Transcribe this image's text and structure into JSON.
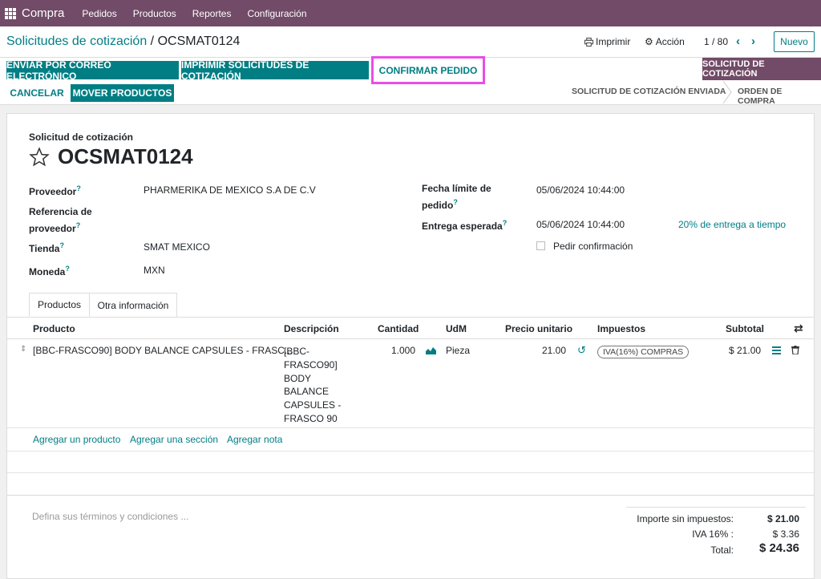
{
  "topbar": {
    "brand": "Compra",
    "menu": [
      "Pedidos",
      "Productos",
      "Reportes",
      "Configuración"
    ]
  },
  "breadcrumb": {
    "parent": "Solicitudes de cotización",
    "separator": "/",
    "current": "OCSMAT0124"
  },
  "cp_actions": {
    "print": "Imprimir",
    "action": "Acción",
    "pager": "1 / 80",
    "new": "Nuevo"
  },
  "buttons": {
    "send_email": "ENVIAR POR CORREO ELECTRÓNICO",
    "print_rfq": "IMPRIMIR SOLICITUDES DE COTIZACIÓN",
    "confirm": "CONFIRMAR PEDIDO",
    "cancel": "CANCELAR",
    "move": "MOVER PRODUCTOS"
  },
  "statusbar": {
    "active": "SOLICITUD DE COTIZACIÓN",
    "sent": "SOLICITUD DE COTIZACIÓN ENVIADA",
    "order": "ORDEN DE COMPRA"
  },
  "form": {
    "subtitle": "Solicitud de cotización",
    "name": "OCSMAT0124",
    "proveedor_label": "Proveedor",
    "proveedor": "PHARMERIKA DE MEXICO S.A DE C.V",
    "ref_label_1": "Referencia de",
    "ref_label_2": "proveedor",
    "tienda_label": "Tienda",
    "tienda": "SMAT MEXICO",
    "moneda_label": "Moneda",
    "moneda": "MXN",
    "fecha_label_1": "Fecha límite de",
    "fecha_label_2": "pedido",
    "fecha": "05/06/2024 10:44:00",
    "entrega_label": "Entrega esperada",
    "entrega": "05/06/2024 10:44:00",
    "entrega_pct": "20% de entrega a tiempo",
    "pedir_conf": "Pedir confirmación",
    "q": "?"
  },
  "tabs": {
    "productos": "Productos",
    "otra": "Otra información"
  },
  "table": {
    "headers": {
      "producto": "Producto",
      "descripcion": "Descripción",
      "cantidad": "Cantidad",
      "udm": "UdM",
      "precio": "Precio unitario",
      "impuestos": "Impuestos",
      "subtotal": "Subtotal"
    },
    "row": {
      "producto": "[BBC-FRASCO90] BODY BALANCE CAPSULES - FRASC...",
      "descripcion": [
        "[BBC-",
        "FRASCO90]",
        "BODY",
        "BALANCE",
        "CAPSULES -",
        "FRASCO 90"
      ],
      "cantidad": "1.000",
      "udm": "Pieza",
      "precio": "21.00",
      "impuesto": "IVA(16%) COMPRAS",
      "subtotal": "$ 21.00"
    },
    "add": {
      "product": "Agregar un producto",
      "section": "Agregar una sección",
      "note": "Agregar nota"
    }
  },
  "terms_placeholder": "Defina sus términos y condiciones ...",
  "totals": {
    "untaxed_label": "Importe sin impuestos:",
    "untaxed": "$ 21.00",
    "iva_label": "IVA 16% :",
    "iva": "$ 3.36",
    "total_label": "Total:",
    "total": "$ 24.36"
  },
  "colors": {
    "brand": "#714b67",
    "accent": "#017e84",
    "highlight": "#e84ee6"
  }
}
